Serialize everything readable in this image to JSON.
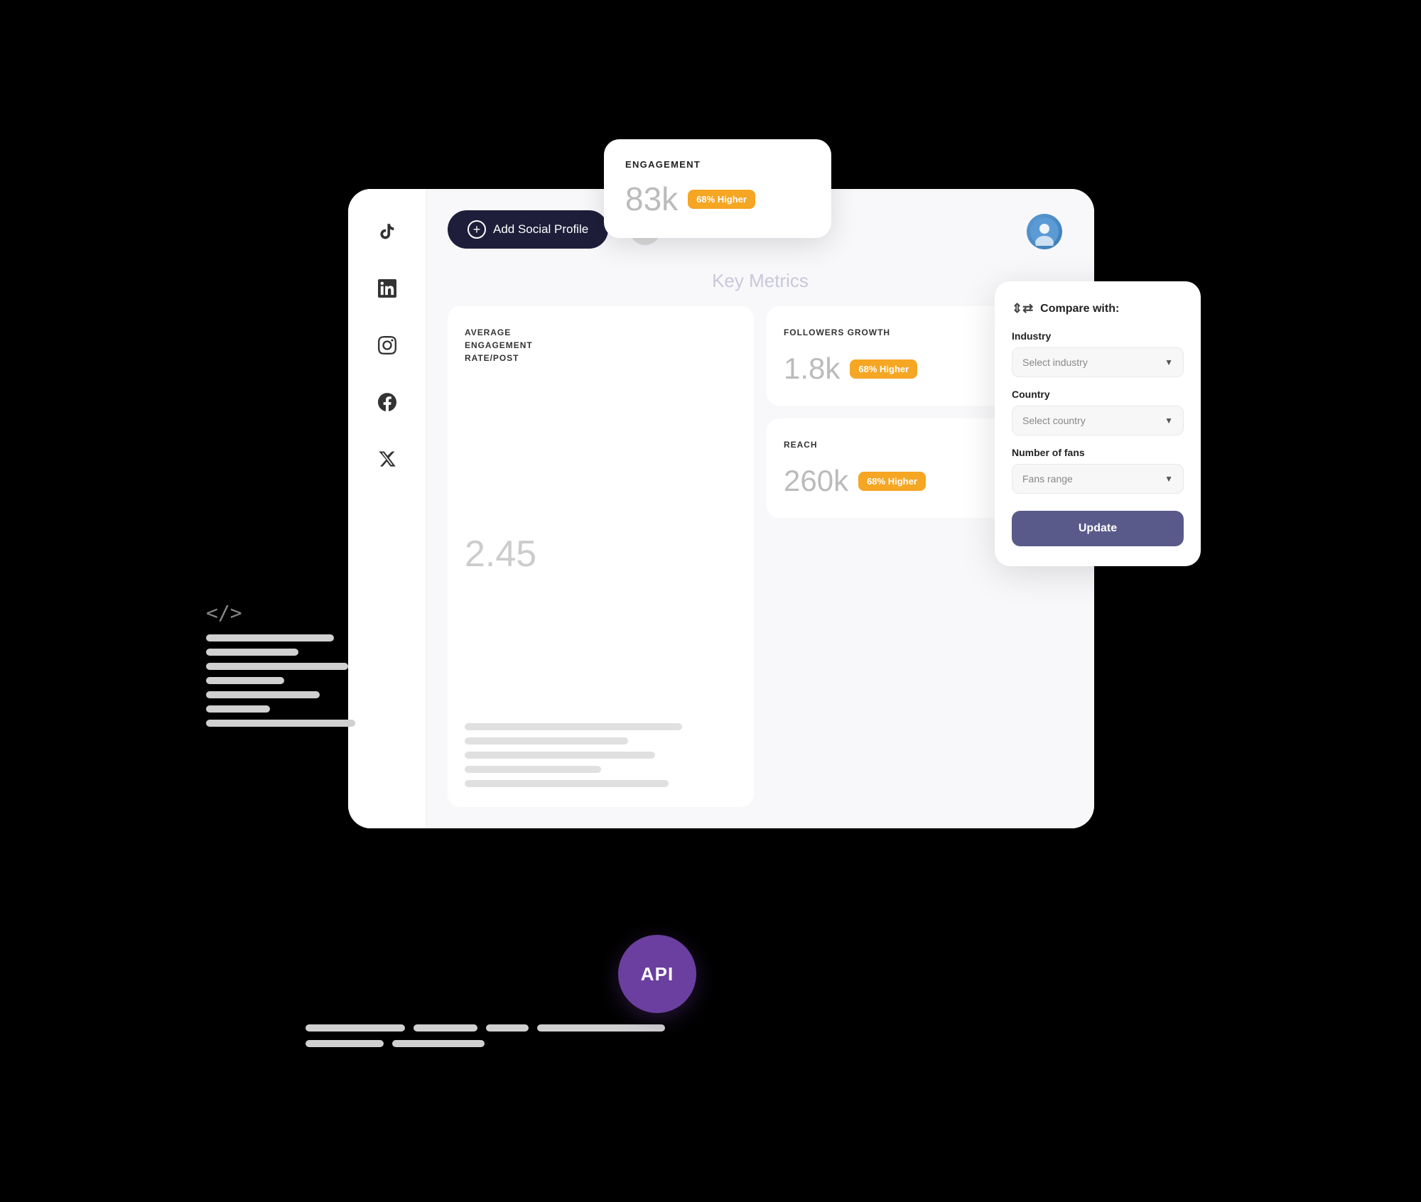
{
  "sidebar": {
    "icons": [
      {
        "name": "tiktok-icon",
        "glyph": "✦"
      },
      {
        "name": "linkedin-icon",
        "glyph": "in"
      },
      {
        "name": "instagram-icon",
        "glyph": "◎"
      },
      {
        "name": "facebook-icon",
        "glyph": "f"
      },
      {
        "name": "twitter-icon",
        "glyph": "𝕏"
      }
    ]
  },
  "topbar": {
    "add_profile_label": "Add Social Profile"
  },
  "engagement_card": {
    "label": "ENGAGEMENT",
    "value": "83k",
    "badge": "68% Higher"
  },
  "key_metrics": {
    "label": "Key Metrics",
    "cards": [
      {
        "title": "AVERAGE\nENGAGEMENT\nRATE/POST",
        "value": "2.45",
        "badge": null
      },
      {
        "title": "FOLLOWERS GROWTH",
        "value": "1.8k",
        "badge": "68% Higher"
      },
      {
        "title": "REACH",
        "value": "260k",
        "badge": "68% Higher"
      }
    ]
  },
  "compare_panel": {
    "title": "Compare with:",
    "industry_label": "Industry",
    "industry_placeholder": "Select industry",
    "country_label": "Country",
    "country_placeholder": "Select country",
    "fans_label": "Number of fans",
    "fans_placeholder": "Fans range",
    "update_label": "Update"
  },
  "api_badge": {
    "text": "API"
  }
}
